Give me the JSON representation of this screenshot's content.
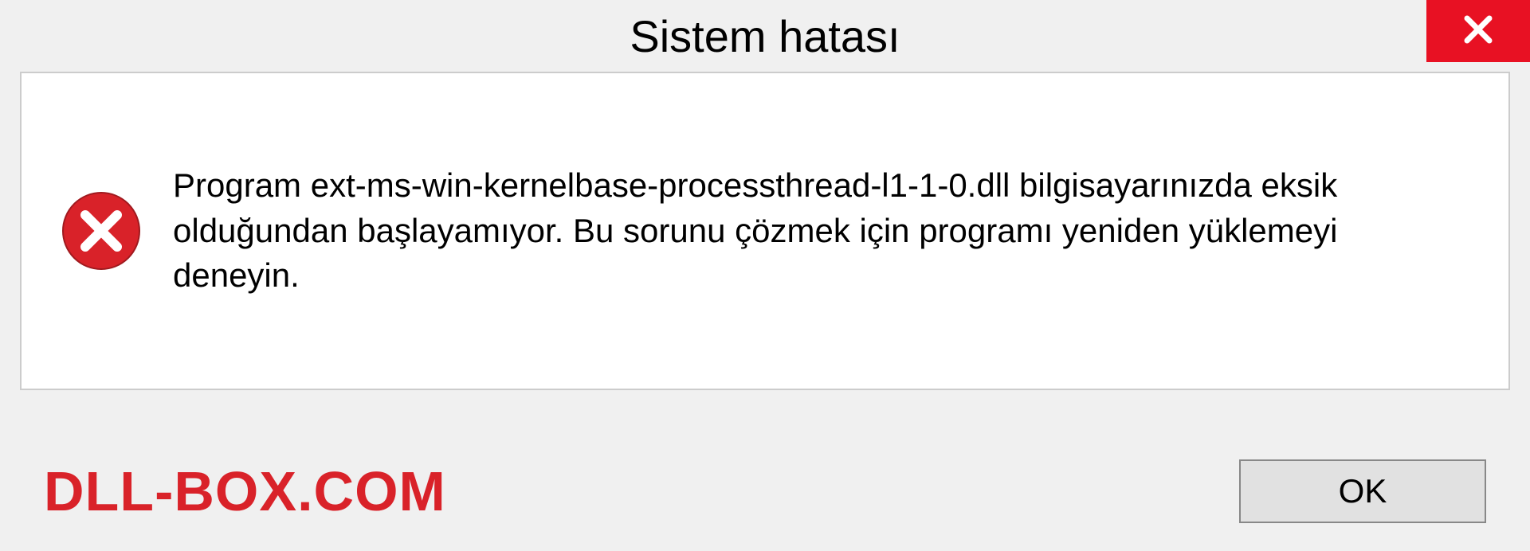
{
  "dialog": {
    "title": "Sistem hatası",
    "message": "Program ext-ms-win-kernelbase-processthread-l1-1-0.dll bilgisayarınızda eksik olduğundan başlayamıyor. Bu sorunu çözmek için programı yeniden yüklemeyi deneyin.",
    "ok_label": "OK"
  },
  "watermark": "DLL-BOX.COM"
}
